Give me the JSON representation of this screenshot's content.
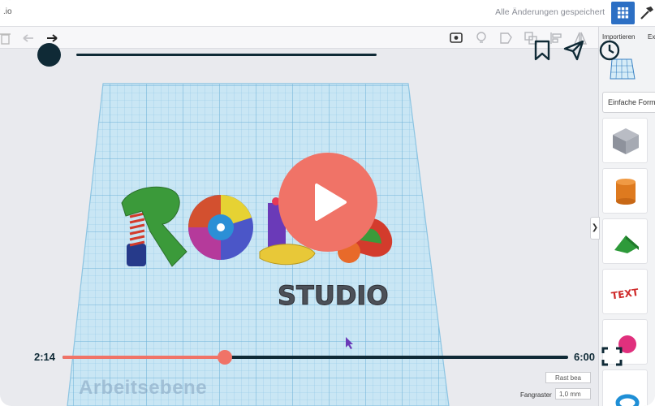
{
  "app": {
    "name": ".io",
    "save_status": "Alle Änderungen gespeichert"
  },
  "toolbar": {
    "icons": [
      "trash-icon",
      "undo-icon",
      "redo-icon",
      "notes-icon",
      "bulb-icon",
      "shape-icon",
      "group-icon",
      "align-icon",
      "mirror-icon"
    ]
  },
  "right_panel": {
    "import_label": "Importieren",
    "export_label": "Ex",
    "shape_category": "Einfache Form",
    "shapes": [
      "box",
      "cylinder",
      "roof",
      "text",
      "sphere"
    ]
  },
  "workplane": {
    "label": "Arbeitsebene",
    "edit_grid_label": "Rast bea",
    "snap_label": "Fangraster",
    "snap_value": "1,0 mm"
  },
  "scene": {
    "studio_text": "STUDIO"
  },
  "video": {
    "current_time": "2:14",
    "duration": "6:00",
    "progress": 0.3217,
    "colors": {
      "accent": "#f07367",
      "dark": "#0f2a36"
    }
  }
}
